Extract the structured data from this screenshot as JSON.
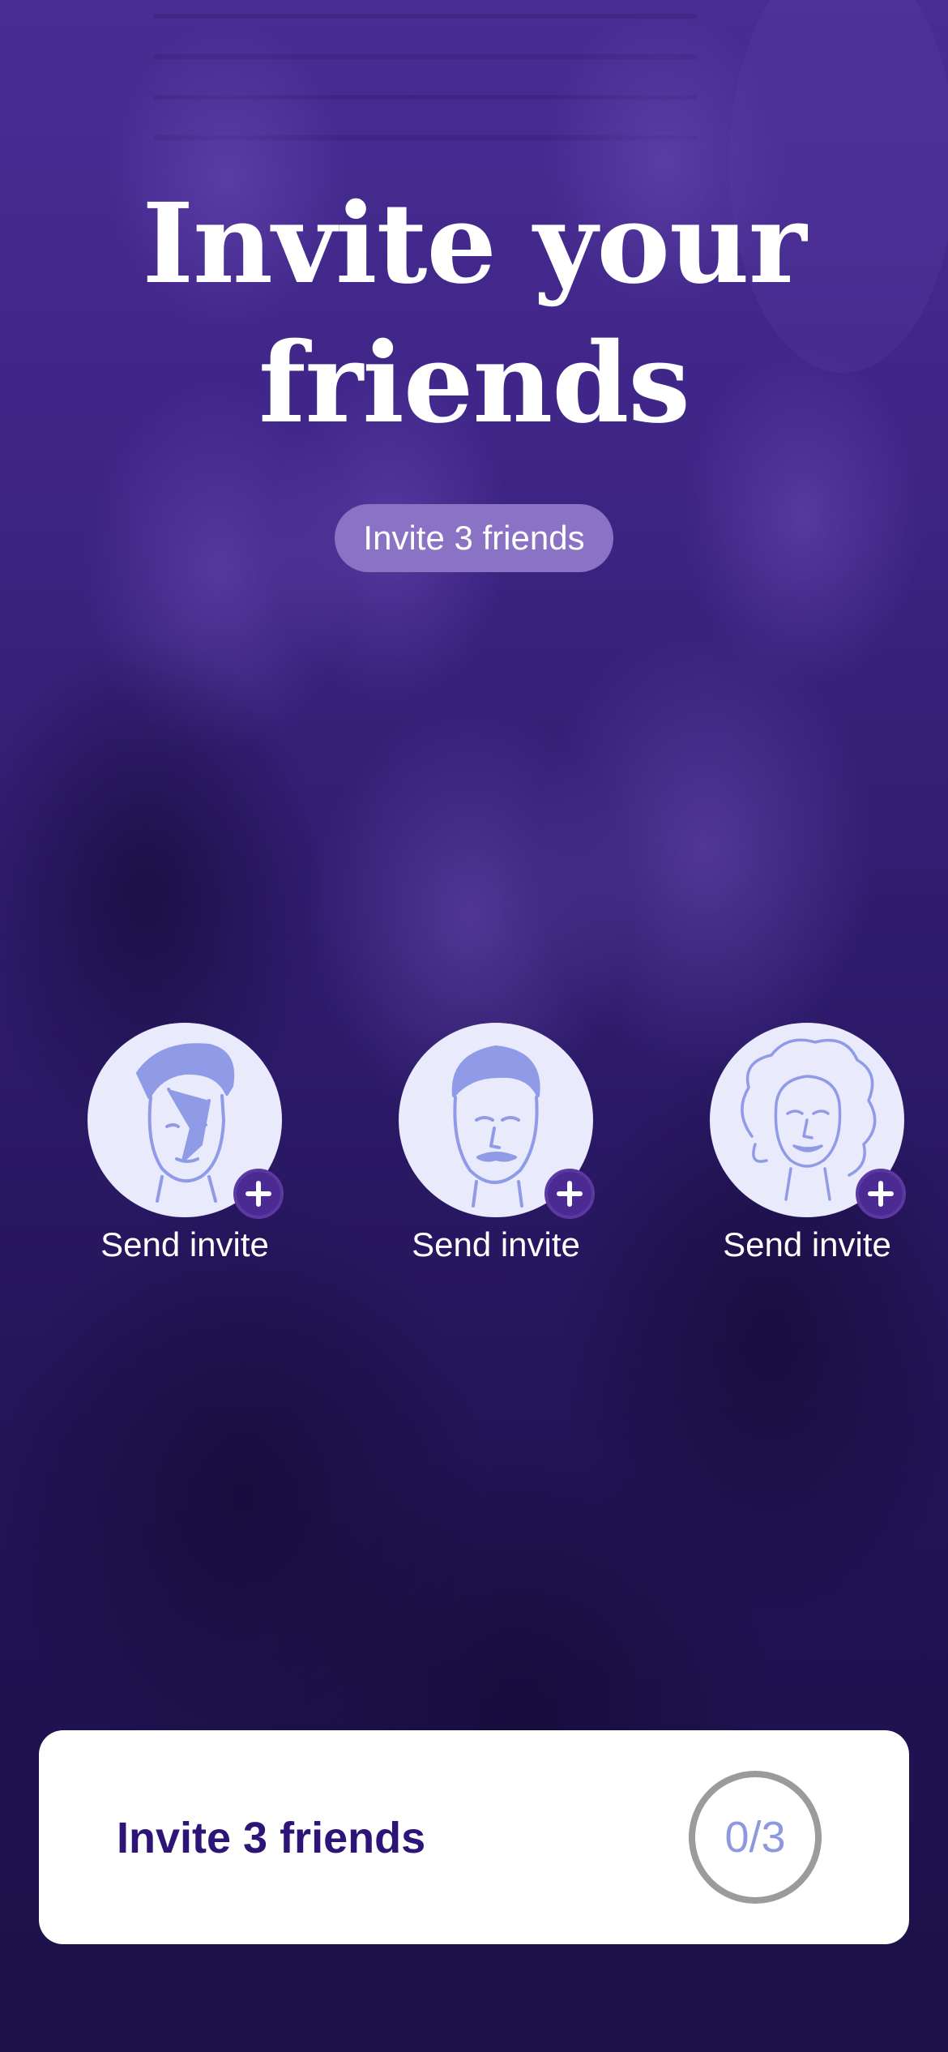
{
  "header": {
    "title_line1": "Invite your",
    "title_line2": "friends",
    "badge": "Invite 3 friends"
  },
  "invites": [
    {
      "label": "Send invite",
      "avatar": "avatar-rocker-icon"
    },
    {
      "label": "Send invite",
      "avatar": "avatar-mustache-man-icon"
    },
    {
      "label": "Send invite",
      "avatar": "avatar-curly-hair-woman-icon"
    }
  ],
  "footer": {
    "label": "Invite 3 friends",
    "progress": "0/3"
  },
  "colors": {
    "background_top": "#4a2d94",
    "background_bottom": "#1c1049",
    "badge": "#8a72c4",
    "avatar_bg": "#e9eafc",
    "accent": "#4b2a92",
    "footer_text": "#2d1476",
    "progress_text": "#8d98de"
  }
}
